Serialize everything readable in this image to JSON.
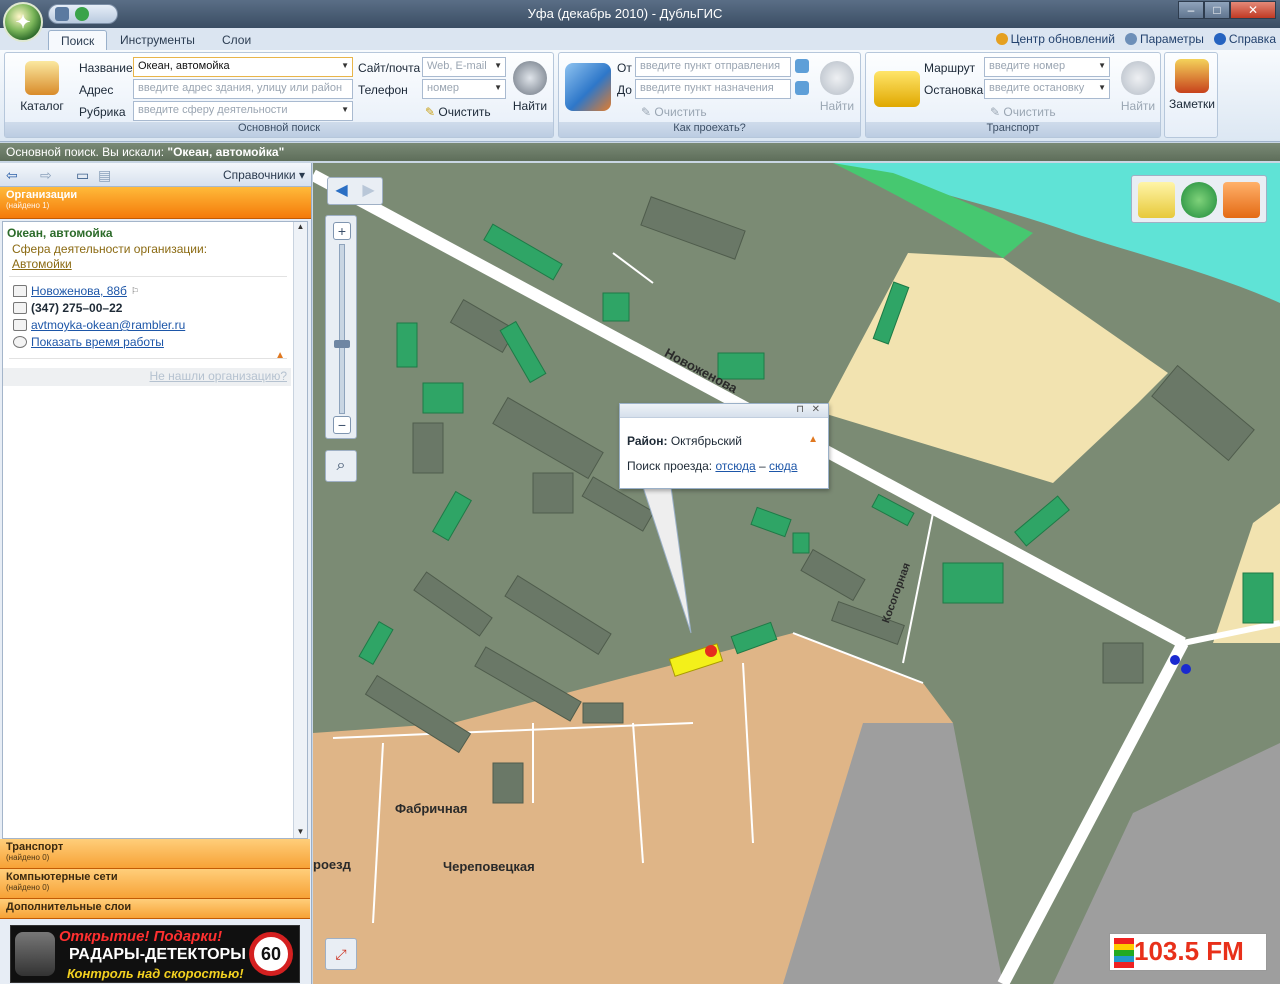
{
  "window": {
    "title": "Уфа (декабрь 2010) - ДубльГИС",
    "buttons": [
      "–",
      "□",
      "✕"
    ]
  },
  "tabs": [
    "Поиск",
    "Инструменты",
    "Слои"
  ],
  "topright": {
    "updates": "Центр обновлений",
    "params": "Параметры",
    "help": "Справка"
  },
  "ribbon": {
    "main_search": {
      "group_label": "Основной поиск",
      "catalog": "Каталог",
      "name_label": "Название",
      "name_value": "Океан, автомойка",
      "address_label": "Адрес",
      "address_placeholder": "введите адрес здания, улицу или район",
      "rubric_label": "Рубрика",
      "rubric_placeholder": "введите сферу деятельности",
      "site_label": "Сайт/почта",
      "site_placeholder": "Web, E-mail",
      "phone_label": "Телефон",
      "phone_placeholder": "номер",
      "clear": "Очистить",
      "find": "Найти"
    },
    "route": {
      "group_label": "Как проехать?",
      "from_label": "От",
      "from_placeholder": "введите пункт отправления",
      "to_label": "До",
      "to_placeholder": "введите пункт назначения",
      "clear": "Очистить",
      "find": "Найти"
    },
    "transport": {
      "group_label": "Транспорт",
      "route_label": "Маршрут",
      "route_placeholder": "введите номер",
      "stop_label": "Остановка",
      "stop_placeholder": "введите остановку",
      "clear": "Очистить",
      "find": "Найти"
    },
    "notes": "Заметки"
  },
  "status": {
    "prefix": "Основной поиск. Вы искали:",
    "query": "\"Океан, автомойка\""
  },
  "left": {
    "directories": "Справочники",
    "category_orgs": "Организации",
    "category_orgs_count": "(найдено 1)",
    "org": {
      "name": "Океан, автомойка",
      "field_label": "Сфера деятельности организации:",
      "rubric": "Автомойки",
      "address": "Новоженова, 88б",
      "phone": "(347) 275–00–22",
      "email": "avtmoyka-okean@rambler.ru",
      "hours": "Показать время работы"
    },
    "not_found": "Не нашли организацию?",
    "categories": [
      {
        "name": "Транспорт",
        "count": "(найдено 0)"
      },
      {
        "name": "Компьютерные сети",
        "count": "(найдено 0)"
      },
      {
        "name": "Дополнительные слои",
        "count": ""
      }
    ],
    "ad": {
      "line1": "Открытие! Подарки!",
      "line2": "РАДАРЫ-ДЕТЕКТОРЫ",
      "line3": "Контроль над скоростью!",
      "speed": "60"
    }
  },
  "map": {
    "popup": {
      "district_label": "Район:",
      "district_value": "Октябрьский",
      "route_label": "Поиск проезда:",
      "from": "отсюда",
      "dash": "–",
      "to": "сюда"
    },
    "streets": [
      "Новоженова",
      "Косогорная",
      "Фабричная",
      "Череповецкая",
      "роезд"
    ],
    "radio": "103.5 FM"
  },
  "colors": {
    "accent_orange": "#f47a0a",
    "water": "#5fe3d6",
    "building_green": "#2fa566"
  }
}
